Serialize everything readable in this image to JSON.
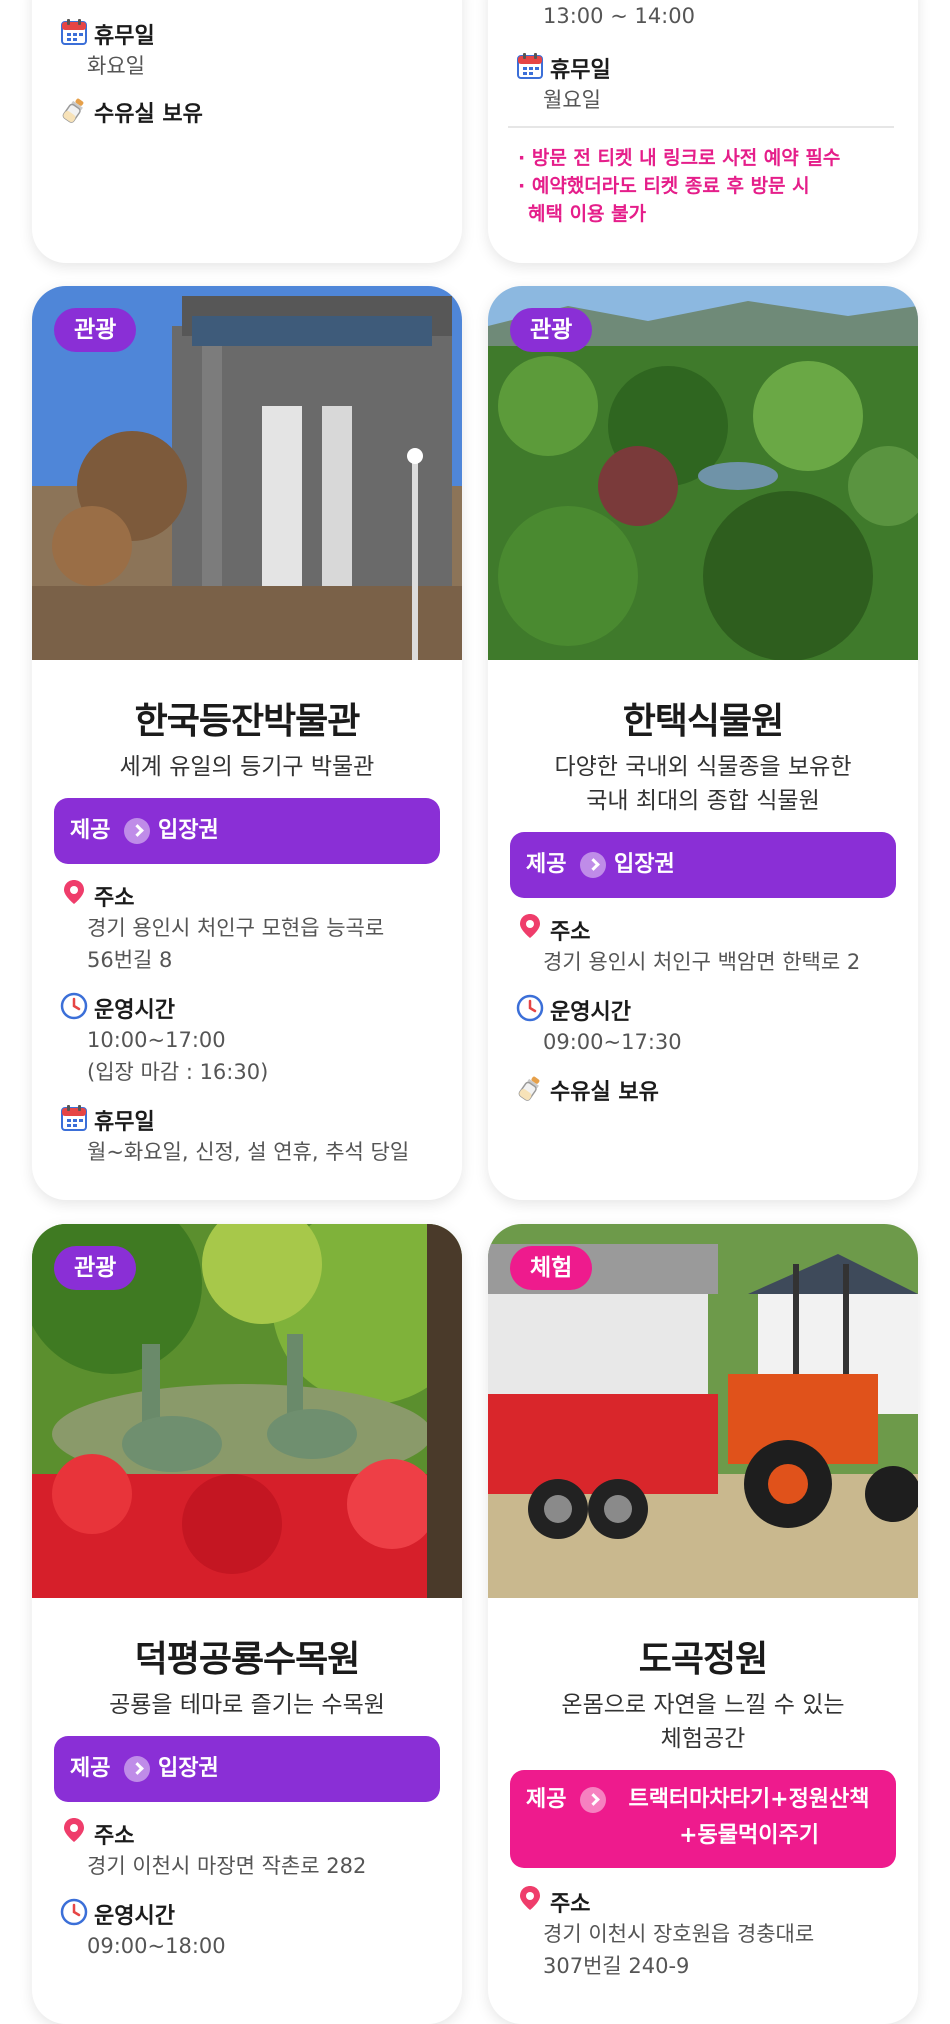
{
  "top_left": {
    "closed_label": "휴무일",
    "closed_value": "화요일",
    "nursing_label": "수유실 보유"
  },
  "top_right": {
    "hours_value": "13:00 ~ 14:00",
    "closed_label": "휴무일",
    "closed_value": "월요일",
    "notes": [
      "· 방문 전 티켓 내 링크로 사전 예약 필수",
      "· 예약했더라도 티켓 종료 후 방문 시",
      "혜택 이용 불가"
    ]
  },
  "cards": [
    {
      "tag": "관광",
      "title": "한국등잔박물관",
      "desc": [
        "세계 유일의 등기구 박물관"
      ],
      "provide_label": "제공",
      "provide_value": "입장권",
      "address_label": "주소",
      "address": [
        "경기 용인시 처인구 모현읍 능곡로",
        "56번길 8"
      ],
      "hours_label": "운영시간",
      "hours": [
        "10:00~17:00",
        "(입장 마감 : 16:30)"
      ],
      "closed_label": "휴무일",
      "closed": "월~화요일, 신정, 설 연휴, 추석 당일"
    },
    {
      "tag": "관광",
      "title": "한택식물원",
      "desc": [
        "다양한 국내외 식물종을 보유한",
        "국내 최대의 종합 식물원"
      ],
      "provide_label": "제공",
      "provide_value": "입장권",
      "address_label": "주소",
      "address": [
        "경기 용인시 처인구 백암면 한택로 2"
      ],
      "hours_label": "운영시간",
      "hours": [
        "09:00~17:30"
      ],
      "nursing_label": "수유실 보유"
    },
    {
      "tag": "관광",
      "title": "덕평공룡수목원",
      "desc": [
        "공룡을 테마로 즐기는 수목원"
      ],
      "provide_label": "제공",
      "provide_value": "입장권",
      "address_label": "주소",
      "address": [
        "경기 이천시 마장면 작촌로 282"
      ],
      "hours_label": "운영시간",
      "hours": [
        "09:00~18:00"
      ]
    },
    {
      "tag": "체험",
      "title": "도곡정원",
      "desc": [
        "온몸으로 자연을 느낄 수 있는",
        "체험공간"
      ],
      "provide_label": "제공",
      "provide_value": [
        "트랙터마차타기+정원산책",
        "+동물먹이주기"
      ],
      "address_label": "주소",
      "address": [
        "경기 이천시 장호원읍 경충대로",
        "307번길 240-9"
      ]
    }
  ],
  "colors": {
    "purple": "#8a2fd6",
    "pink": "#ee1b8d",
    "note": "#e51e8a"
  },
  "icons": {
    "calendar": "calendar-icon",
    "bottle": "baby-bottle-icon",
    "pin": "location-pin-icon",
    "clock": "clock-icon"
  }
}
